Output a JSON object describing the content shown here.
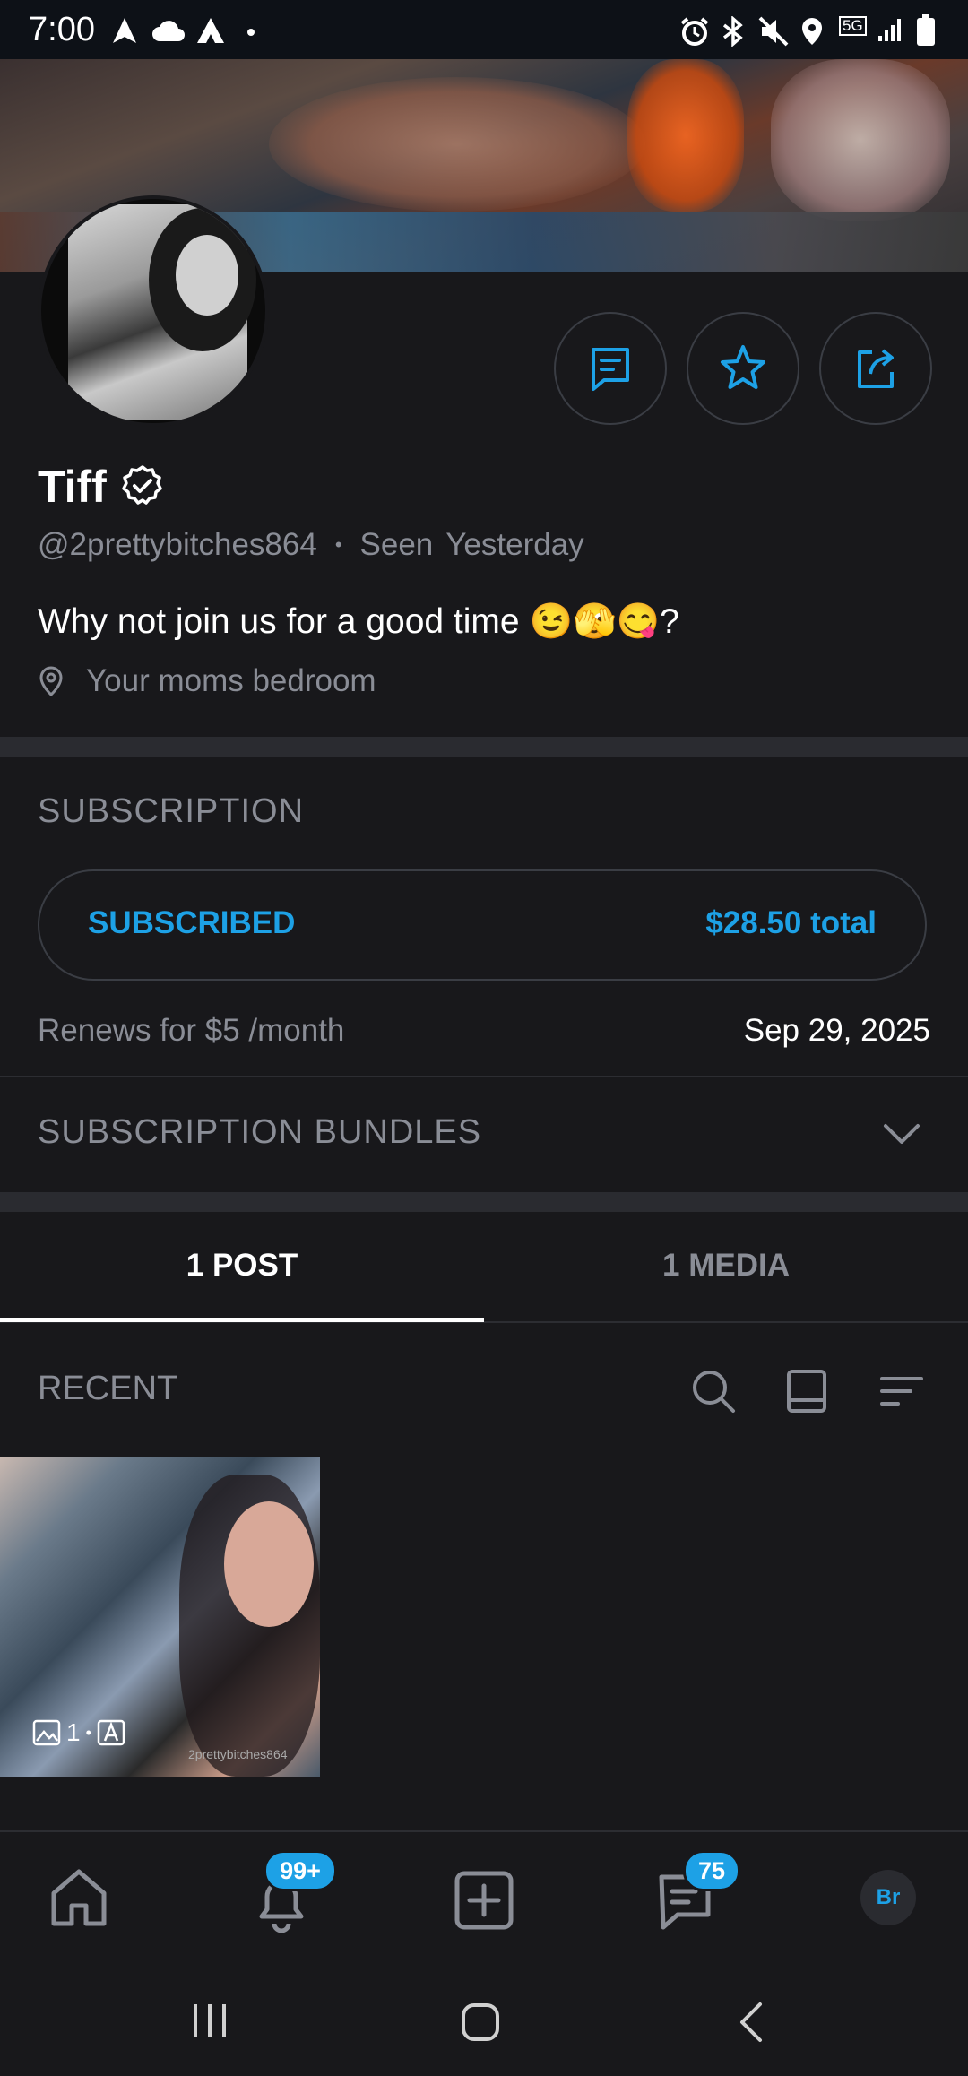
{
  "status_bar": {
    "time": "7:00",
    "network": "5G"
  },
  "profile": {
    "name": "Tiff",
    "handle": "@2prettybitches864",
    "separator": "•",
    "seen_label": "Seen",
    "seen_value": "Yesterday",
    "bio": "Why not join us for a good time 😉🫣😋?",
    "location": "Your moms bedroom"
  },
  "subscription": {
    "section_title": "SUBSCRIPTION",
    "status": "SUBSCRIBED",
    "total": "$28.50 total",
    "renew_text": "Renews for $5 /month",
    "renew_date": "Sep 29, 2025",
    "bundles_title": "SUBSCRIPTION BUNDLES"
  },
  "tabs": [
    {
      "label": "1 POST",
      "active": true
    },
    {
      "label": "1 MEDIA",
      "active": false
    }
  ],
  "feed": {
    "recent_label": "RECENT",
    "post_media_count": "1",
    "post_sep": "•",
    "watermark": "2prettybitches864"
  },
  "bottom_nav": {
    "notifications_badge": "99+",
    "messages_badge": "75",
    "avatar_initials": "Br"
  },
  "colors": {
    "accent": "#1da1e6",
    "background": "#18181b",
    "muted": "#8a8d96"
  },
  "icons": [
    "message-icon",
    "star-icon",
    "share-icon",
    "verified-icon",
    "location-pin-icon",
    "chevron-down-icon",
    "search-icon",
    "grid-view-icon",
    "sort-icon",
    "home-icon",
    "bell-icon",
    "add-icon",
    "chat-icon"
  ]
}
